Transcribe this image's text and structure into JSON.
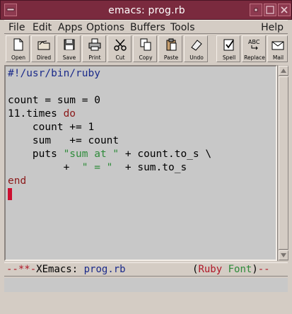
{
  "window": {
    "title": "emacs: prog.rb"
  },
  "menubar": {
    "items": [
      "File",
      "Edit",
      "Apps",
      "Options",
      "Buffers",
      "Tools"
    ],
    "help": "Help"
  },
  "toolbar": {
    "buttons": [
      {
        "label": "Open",
        "icon": "open-file-icon"
      },
      {
        "label": "Dired",
        "icon": "folder-icon"
      },
      {
        "label": "Save",
        "icon": "floppy-icon"
      },
      {
        "label": "Print",
        "icon": "printer-icon"
      },
      {
        "label": "Cut",
        "icon": "scissors-icon"
      },
      {
        "label": "Copy",
        "icon": "copy-icon"
      },
      {
        "label": "Paste",
        "icon": "clipboard-icon"
      },
      {
        "label": "Undo",
        "icon": "eraser-icon"
      },
      {
        "label": "Spell",
        "icon": "spellcheck-icon"
      },
      {
        "label": "Replace",
        "icon": "replace-icon"
      },
      {
        "label": "Mail",
        "icon": "mail-icon"
      }
    ]
  },
  "buffer": {
    "shebang": "#!/usr/bin/ruby",
    "lines": [
      {
        "parts": [
          {
            "t": "count = sum = 0",
            "c": "plain"
          }
        ]
      },
      {
        "parts": [
          {
            "t": "11.times ",
            "c": "plain"
          },
          {
            "t": "do",
            "c": "kw"
          }
        ]
      },
      {
        "parts": [
          {
            "t": "    count += 1",
            "c": "plain"
          }
        ]
      },
      {
        "parts": [
          {
            "t": "    sum   += count",
            "c": "plain"
          }
        ]
      },
      {
        "parts": [
          {
            "t": "    puts ",
            "c": "plain"
          },
          {
            "t": "\"sum at \"",
            "c": "str"
          },
          {
            "t": " + count.to_s \\",
            "c": "plain"
          }
        ]
      },
      {
        "parts": [
          {
            "t": "         +  ",
            "c": "plain"
          },
          {
            "t": "\" = \"",
            "c": "str"
          },
          {
            "t": "  + sum.to_s",
            "c": "plain"
          }
        ]
      },
      {
        "parts": [
          {
            "t": "end",
            "c": "kw"
          }
        ]
      }
    ]
  },
  "modeline": {
    "dashes": "--**-",
    "app": "XEmacs:",
    "buffer_name": "prog.rb",
    "open_paren": "(",
    "mode": "Ruby",
    "minor": "Font",
    "close_paren": ")",
    "trail": "--"
  },
  "colors": {
    "titlebar": "#7a2a3e",
    "keyword": "#8b1a1a",
    "string": "#2e8b3a",
    "shebang": "#1a2a8a",
    "cursor": "#cc1030"
  }
}
